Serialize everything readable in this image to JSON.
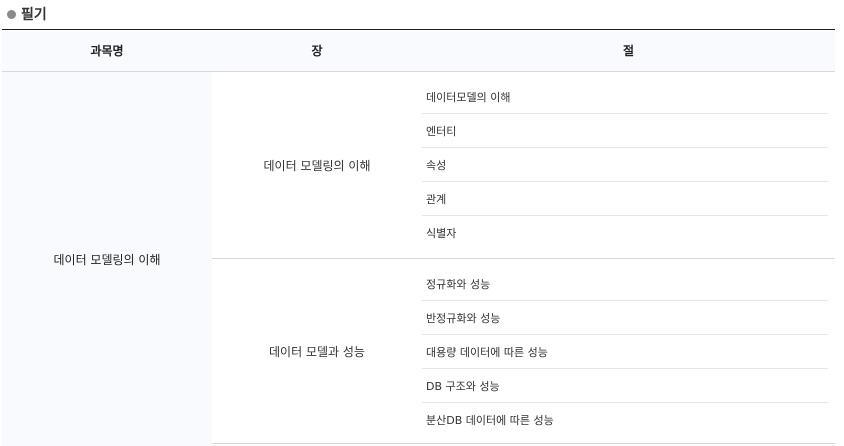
{
  "section": {
    "title": "필기"
  },
  "table": {
    "headers": {
      "subject": "과목명",
      "chapter": "장",
      "section": "절"
    },
    "subject": "데이터 모델링의 이해",
    "chapters": [
      {
        "label": "데이터 모델링의 이해",
        "sections": [
          "데이터모델의 이해",
          "엔터티",
          "속성",
          "관계",
          "식별자"
        ]
      },
      {
        "label": "데이터 모델과 성능",
        "sections": [
          "정규화와 성능",
          "반정규화와 성능",
          "대용량 데이터에 따른 성능",
          "DB 구조와 성능",
          "분산DB 데이터에 따른 성능"
        ]
      }
    ]
  },
  "colors": {
    "header_bg": "#f8fafd",
    "bullet": "#8a8a8a",
    "top_rule": "#1f1f1f"
  }
}
